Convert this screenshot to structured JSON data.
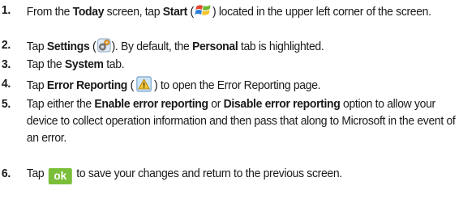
{
  "steps": [
    {
      "num": "1.",
      "t1": "From the ",
      "b1": "Today",
      "t2": " screen, tap ",
      "b2": "Start",
      "t3": " (",
      "icon": "windows-start-icon",
      "t4": ") located in the upper left corner of the screen."
    },
    {
      "num": "2.",
      "t1": "Tap ",
      "b1": "Settings",
      "t2": " (",
      "icon": "settings-icon",
      "t3": "). By default, the ",
      "b2": "Personal",
      "t4": " tab is highlighted."
    },
    {
      "num": "3.",
      "t1": "Tap the ",
      "b1": "System",
      "t2": " tab."
    },
    {
      "num": "4.",
      "t1": "Tap ",
      "b1": "Error Reporting",
      "t2": " (",
      "icon": "error-reporting-icon",
      "t3": ") to open the Error Reporting page."
    },
    {
      "num": "5.",
      "t1": "Tap either the ",
      "b1": "Enable error reporting",
      "t2": " or ",
      "b2": "Disable error reporting",
      "t3": " option to allow your device to collect operation information and then pass that along to Microsoft in the event of an error."
    },
    {
      "num": "6.",
      "t1": "Tap ",
      "ok_label": "ok",
      "t2": " to save your changes and return to the previous screen."
    }
  ],
  "colors": {
    "text": "#1a1a1a",
    "ok_button_bg": "#7bbe3a",
    "ok_button_text": "#ffffff"
  }
}
